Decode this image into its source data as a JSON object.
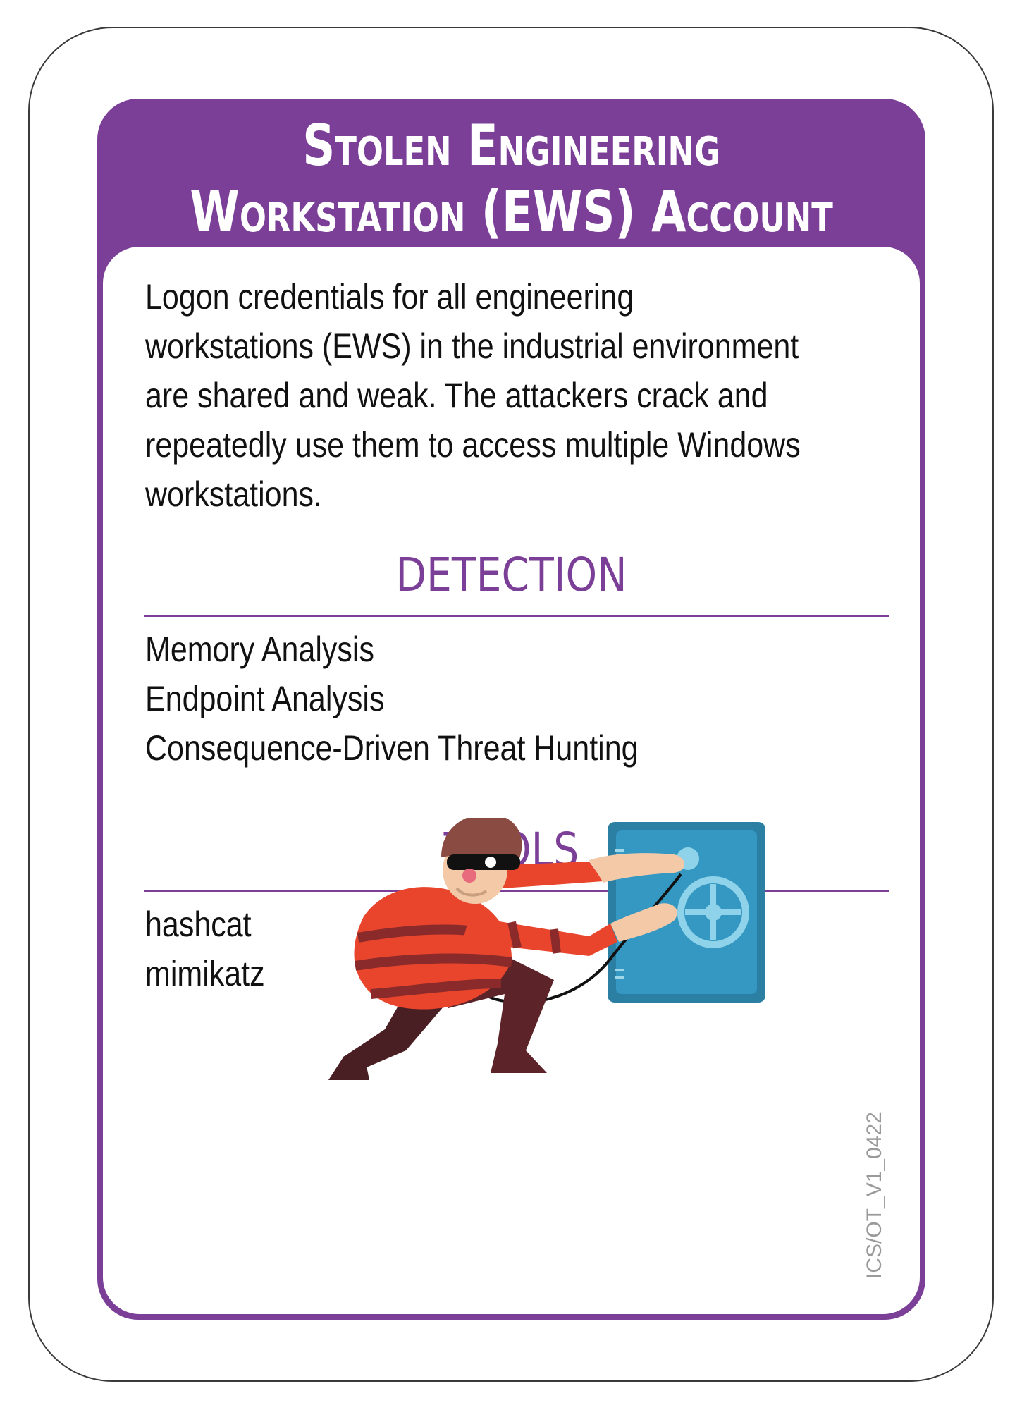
{
  "card": {
    "title_line1": "Stolen Engineering",
    "title_line2": "Workstation (EWS) Account",
    "description_lines": [
      "Logon credentials for all engineering",
      "workstations (EWS) in the industrial environment",
      "are shared and weak. The attackers crack and",
      "repeatedly use them to access multiple Windows",
      "workstations."
    ],
    "detection": {
      "heading": "DETECTION",
      "items": [
        "Memory Analysis",
        "Endpoint Analysis",
        "Consequence-Driven Threat Hunting"
      ]
    },
    "tools": {
      "heading": "TOOLS",
      "items": [
        "hashcat",
        "mimikatz"
      ]
    },
    "version_code": "ICS/OT_V1_0422",
    "illustration": "burglar-cracking-safe"
  },
  "colors": {
    "accent": "#7b3f98",
    "safe": "#2f8fb5",
    "sweater": "#e8452c",
    "hat": "#8a4b42"
  }
}
